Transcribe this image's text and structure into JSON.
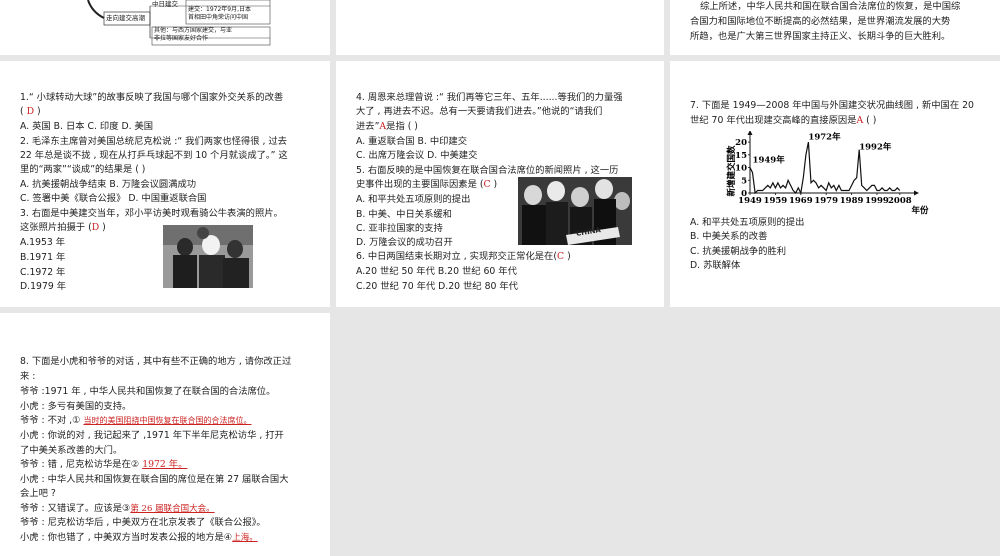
{
  "top_left": {
    "node_label": "走向建交高潮",
    "branch1_title": "中日建交",
    "branch1_text_a": "建交：1972年9月,日本",
    "branch1_text_b": "首相田中角荣访问中国",
    "branch2_text_a": "其他：与西方国家建交，与亚",
    "branch2_text_b": "非拉等国家友好合作"
  },
  "top_right": {
    "line1": "综上所述，中华人民共和国在联合国合法席位的恢复，是中国综",
    "line2": "合国力和国际地位不断提高的必然结果，是世界潮流发展的大势",
    "line3": "所趋，也是广大第三世界国家主持正义、长期斗争的巨大胜利。"
  },
  "panel1": {
    "q1_line1": "1.“ 小球转动大球”的故事反映了我国与哪个国家外交关系的改善",
    "q1_paren_open": "(",
    "q1_answer": "D",
    "q1_paren_close": ")",
    "q1_options": "A. 英国  B. 日本     C. 印度 D. 美国",
    "q2_line1": "2. 毛泽东主席曾对美国总统尼克松说 :“ 我们两家也怪得很 , 过去",
    "q2_line2": "22 年总是谈不拢 , 现在从打乒乓球起不到 10 个月就谈成了。” 这",
    "q2_line3": "里的“两家”“谈成”的结果是 (      )",
    "q2_optAB": "A. 抗美援朝战争结束       B. 万隆会议圆满成功",
    "q2_optCD": "C. 签署中美《联合公报》 D. 中国重返联合国",
    "q3_line1": "3. 右面是中美建交当年，邓小平访美时观看骑公牛表演的照片。",
    "q3_line2a": "这张照片拍摄于",
    "q3_answer": "D",
    "q3_opt_a": "A.1953 年",
    "q3_opt_b": "B.1971 年",
    "q3_opt_c": "C.1972 年",
    "q3_opt_d": "D.1979 年"
  },
  "panel2": {
    "q4_line1": "4. 周恩来总理曾说 :“ 我们再等它三年、五年......等我们的力量强",
    "q4_line2": "大了 , 再进去不迟。总有一天要请我们进去。”他说的“请我们",
    "q4_line3a": "进去”",
    "q4_answer": "A",
    "q4_line3b": "是指 (      )",
    "q4_optAB": "A. 重返联合国        B. 中印建交",
    "q4_optCD": "C. 出席万隆会议     D. 中美建交",
    "q5_line1": "5. 右面反映的是中国恢复在联合国合法席位的新闻照片 , 这一历",
    "q5_line2a": "史事件出现的主要国际因素是",
    "q5_answer": "C",
    "q5_opt_a": "A. 和平共处五项原则的提出",
    "q5_opt_b": "B. 中美、中日关系缓和",
    "q5_opt_c": "C. 亚非拉国家的支持",
    "q5_opt_d": "D. 万隆会议的成功召开",
    "q5_photo_sign": "CHINA",
    "q6_line1a": "6. 中日两国结束长期对立 , 实现邦交正常化是在",
    "q6_answer": "C",
    "q6_optAB": "A.20 世纪 50 年代       B.20 世纪 60 年代",
    "q6_optCD": "C.20 世纪 70 年代       D.20 世纪 80 年代"
  },
  "panel3": {
    "q7_line1": "7. 下面是 1949—2008 年中国与外国建交状况曲线图 , 新中国在 20",
    "q7_line2a": "世纪 70 年代出现建交高峰的直接原因是",
    "q7_answer": "A",
    "q7_opt_a": "A. 和平共处五项原则的提出",
    "q7_opt_b": "B. 中美关系的改善",
    "q7_opt_c": "C. 抗美援朝战争的胜利",
    "q7_opt_d": "D. 苏联解体"
  },
  "chart_data": {
    "type": "line",
    "title": "",
    "ylabel": "新增建交国数",
    "xlabel": "年份",
    "xlim": [
      1949,
      2012
    ],
    "ylim": [
      0,
      22
    ],
    "x_ticks": [
      "1949",
      "1959",
      "1969",
      "1979",
      "1989",
      "1999",
      "2008"
    ],
    "y_ticks": [
      "20",
      "15",
      "10",
      "5",
      "0"
    ],
    "annotations": [
      {
        "text": "1949年",
        "x": 1950,
        "y": 12
      },
      {
        "text": "1972年",
        "x": 1972,
        "y": 21
      },
      {
        "text": "1992年",
        "x": 1992,
        "y": 17
      }
    ],
    "series": [
      {
        "x": [
          1949,
          1950,
          1951,
          1952,
          1953,
          1954,
          1955,
          1956,
          1957,
          1958,
          1959,
          1960,
          1961,
          1962,
          1963,
          1964,
          1965,
          1966,
          1967,
          1968,
          1969,
          1970,
          1971,
          1972,
          1973,
          1974,
          1975,
          1976,
          1977,
          1978,
          1979,
          1980,
          1981,
          1982,
          1983,
          1984,
          1985,
          1986,
          1987,
          1988,
          1989,
          1990,
          1991,
          1992,
          1993,
          1994,
          1995,
          1996,
          1997,
          1998,
          1999,
          2000,
          2001,
          2002,
          2003,
          2004,
          2005,
          2006,
          2007,
          2008
        ],
        "y": [
          10,
          8,
          0,
          1,
          1,
          1,
          2,
          3,
          2,
          4,
          2,
          4,
          2,
          3,
          2,
          5,
          3,
          1,
          0,
          2,
          0,
          6,
          15,
          20,
          4,
          5,
          4,
          2,
          3,
          2,
          1,
          4,
          2,
          3,
          1,
          3,
          1,
          1,
          1,
          1,
          3,
          5,
          6,
          17,
          3,
          2,
          1,
          2,
          3,
          3,
          1,
          1,
          2,
          1,
          1,
          2,
          1,
          1,
          2,
          1
        ]
      }
    ]
  },
  "panel4": {
    "q8_line1": "8. 下面是小虎和爷爷的对话 , 其中有些不正确的地方 , 请你改正过",
    "q8_line2": "来 :",
    "d1": "爷爷 :1971 年 , 中华人民共和国恢复了在联合国的合法席位。",
    "d2": "小虎 : 多亏有美国的支持。",
    "d3a": "爷爷 : 不对 ,①",
    "d3_answer": "当时的美国阻挠中国恢复在联合国的合法席位。",
    "d4": "小虎 : 你说的对 , 我记起来了 ,1971 年下半年尼克松访华 , 打开",
    "d5": "了中美关系改善的大门。",
    "d6a": "爷爷 : 错 , 尼克松访华是在②",
    "d6_answer": "1972 年。",
    "d7": "小虎 : 中华人民共和国恢复在联合国的席位是在第 27 届联合国大",
    "d8": "会上吧 ?",
    "d9a": "爷爷 : 又错误了。应该是③",
    "d9_answer": "第 26 届联合国大会。",
    "d10": "爷爷 : 尼克松访华后 , 中美双方在北京发表了《联合公报》。",
    "d11a": "小虎 : 你也错了 , 中美双方当时发表公报的地方是④",
    "d11_answer": "上海。"
  }
}
